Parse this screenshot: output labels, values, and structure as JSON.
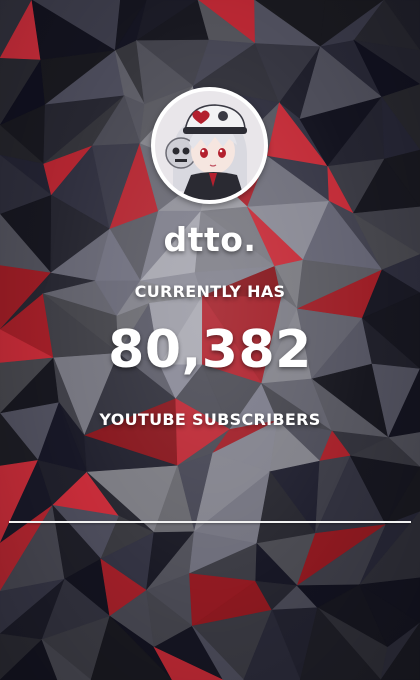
{
  "channel": {
    "name": "dtto."
  },
  "counter": {
    "prefix_label": "CURRENTLY HAS",
    "value": "80,382",
    "suffix_label": "YOUTUBE SUBSCRIBERS"
  },
  "colors": {
    "text": "#ffffff",
    "divider": "#f2f2f2",
    "accent_red": "#8e2330",
    "avatar_border": "#ffffff"
  },
  "icons": {
    "avatar": "anime-girl-avatar-icon"
  }
}
